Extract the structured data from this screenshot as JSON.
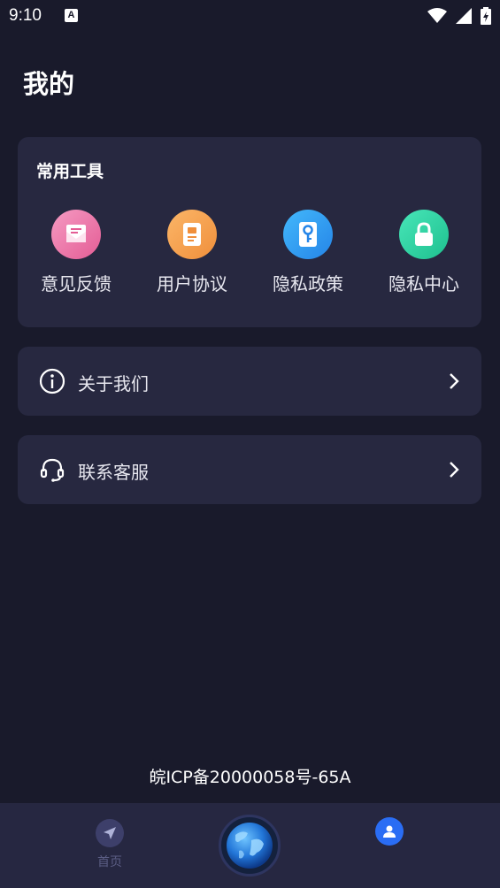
{
  "status_bar": {
    "time": "9:10",
    "notification_icon": "A"
  },
  "page": {
    "title": "我的"
  },
  "tools": {
    "title": "常用工具",
    "items": [
      {
        "label": "意见反馈",
        "icon": "mail-icon",
        "color": "#ee7fae"
      },
      {
        "label": "用户协议",
        "icon": "document-icon",
        "color": "#f7a553"
      },
      {
        "label": "隐私政策",
        "icon": "key-icon",
        "color": "#35a7f4"
      },
      {
        "label": "隐私中心",
        "icon": "lock-icon",
        "color": "#34d8a8"
      }
    ]
  },
  "menu": {
    "about": {
      "label": "关于我们",
      "icon": "info-icon"
    },
    "contact": {
      "label": "联系客服",
      "icon": "headset-icon"
    }
  },
  "footer": {
    "icp": "皖ICP备20000058号-65A"
  },
  "tab_bar": {
    "home_label": "首页",
    "accent": "#2a6df4"
  }
}
